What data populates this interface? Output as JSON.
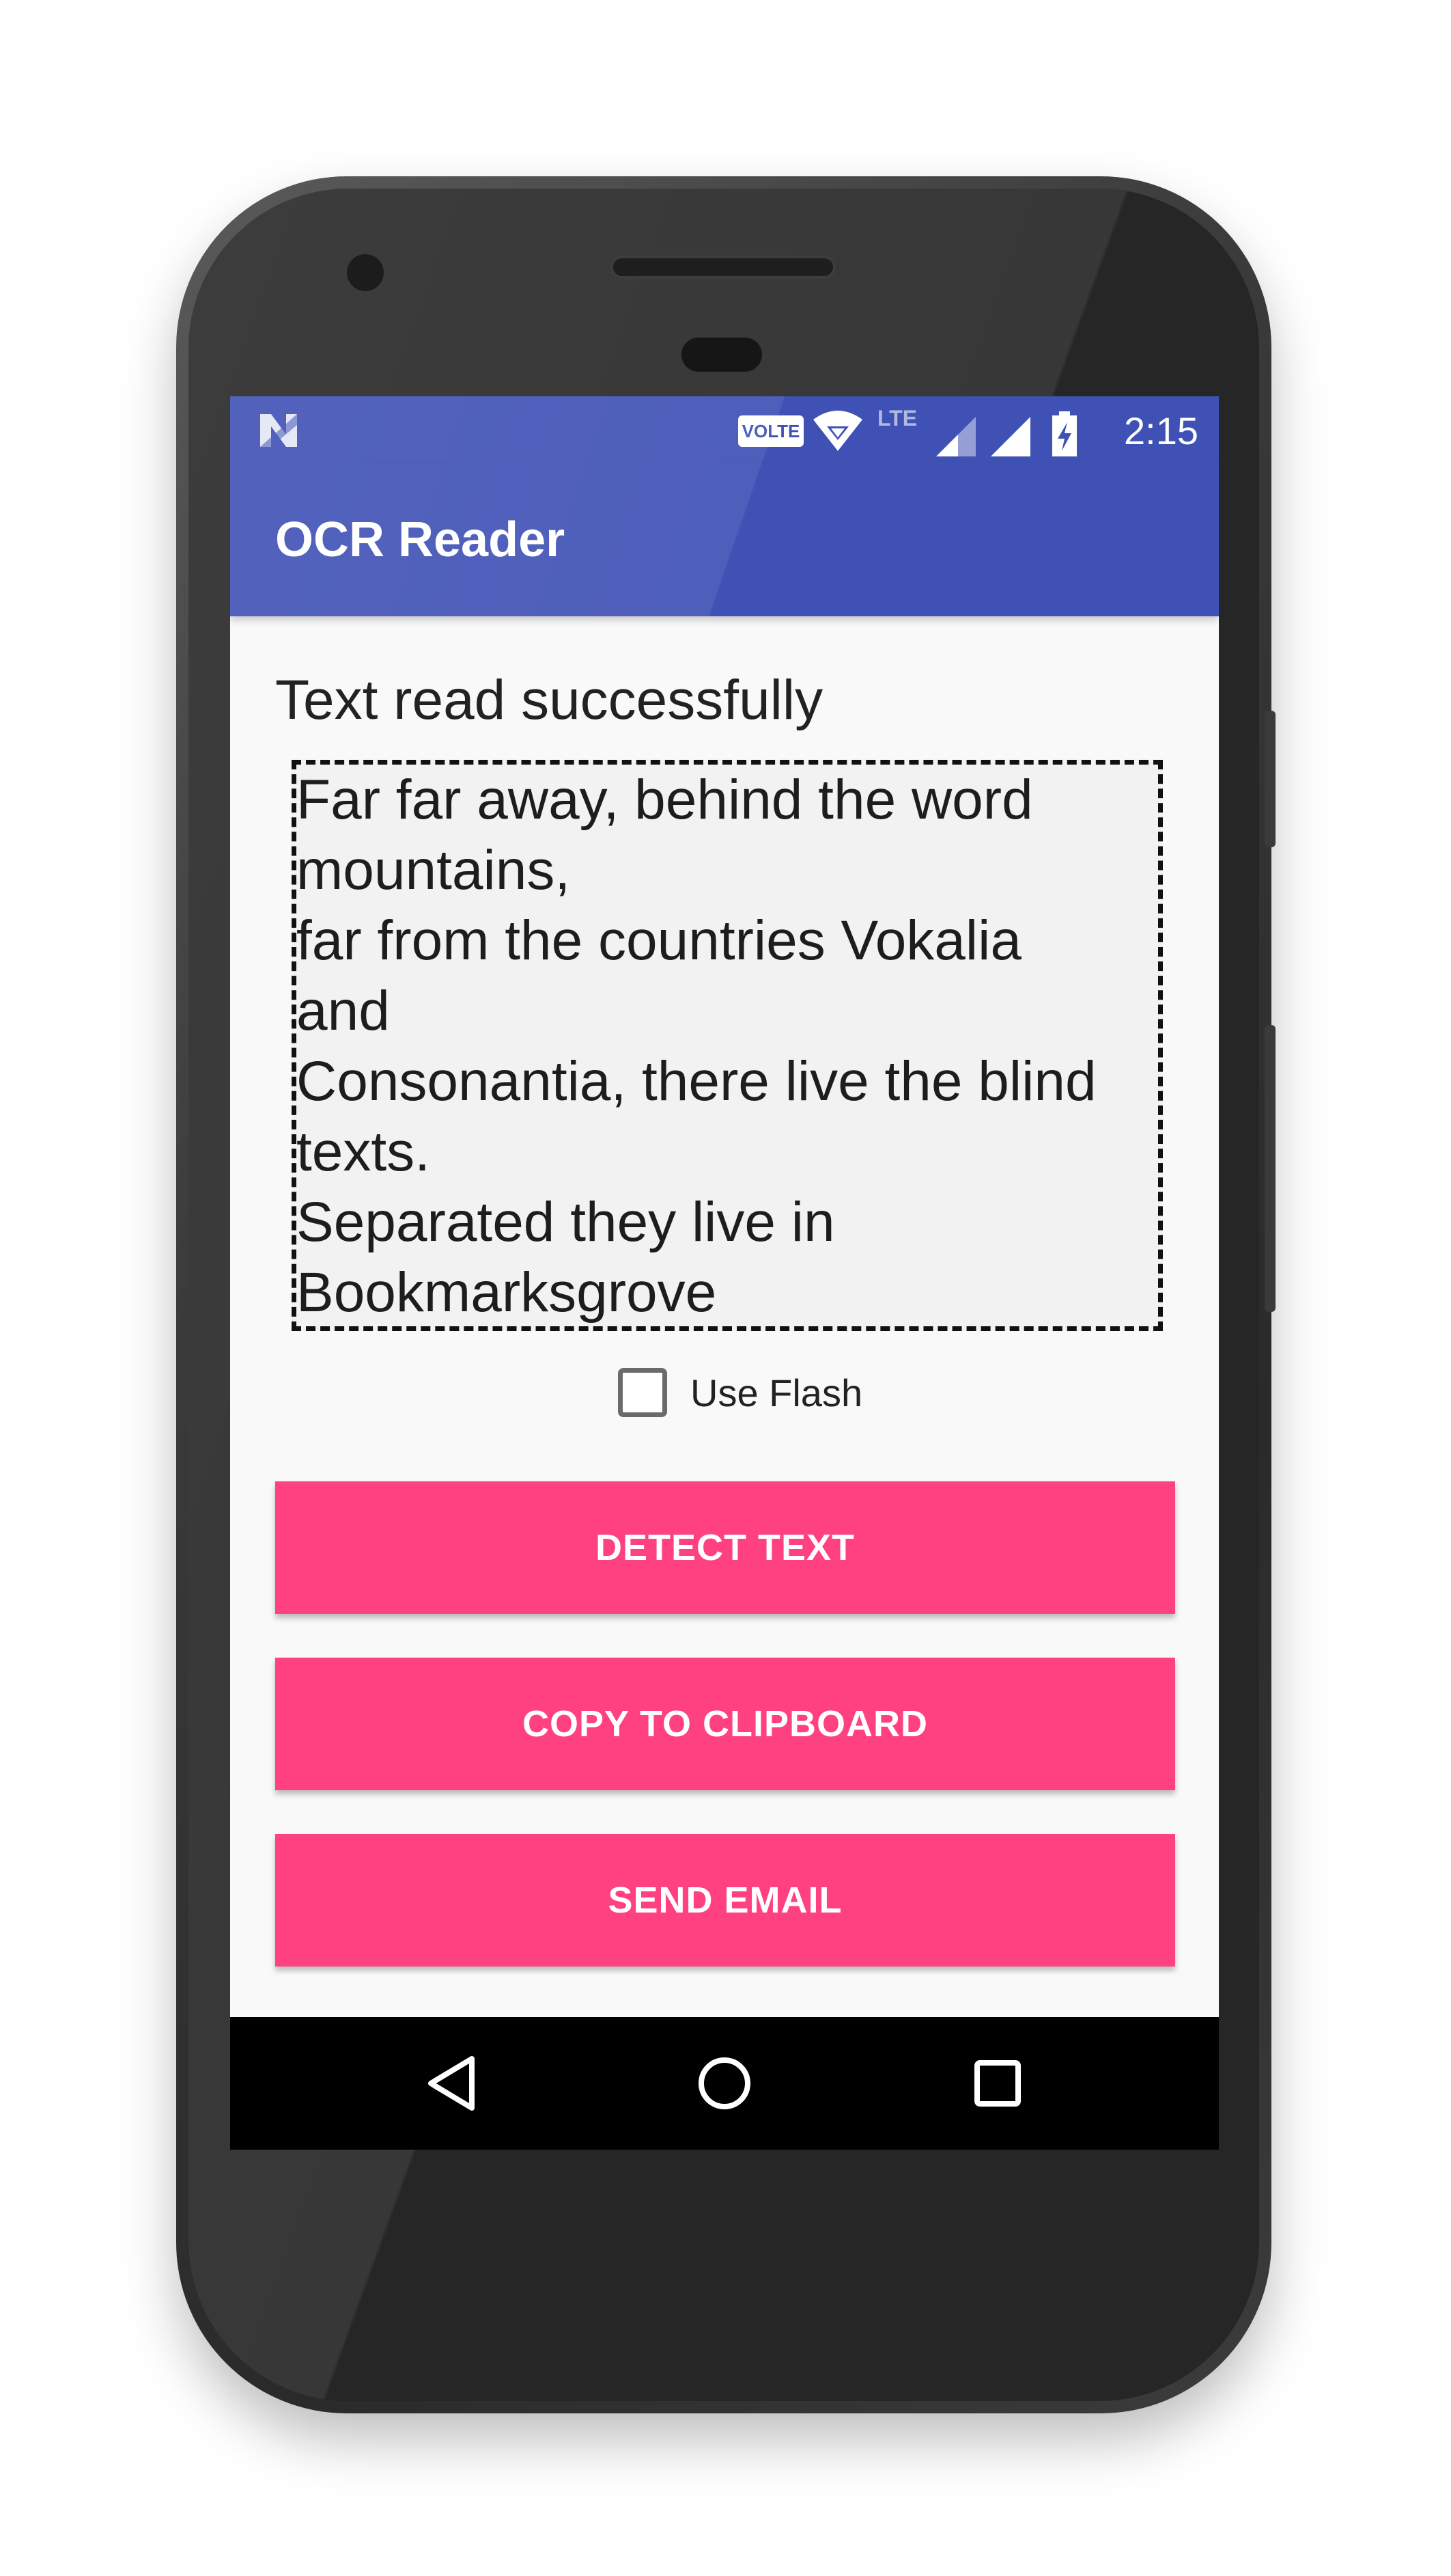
{
  "status_bar": {
    "time": "2:15",
    "volte_badge": "VOLTE",
    "lte_label": "LTE",
    "icons": [
      "notification-n-icon",
      "volte-icon",
      "wifi-icon",
      "lte-signal-icon",
      "cell-signal-icon",
      "battery-charging-icon"
    ]
  },
  "toolbar": {
    "title": "OCR Reader"
  },
  "main": {
    "status_message": "Text read successfully",
    "ocr_text": "Far far away, behind the word\nmountains,\nfar from the countries Vokalia\nand\nConsonantia, there live the blind\ntexts.\nSeparated they live in\nBookmarksgrove",
    "use_flash_label": "Use Flash",
    "use_flash_checked": false,
    "buttons": {
      "detect": "DETECT TEXT",
      "copy": "COPY TO CLIPBOARD",
      "email": "SEND EMAIL"
    }
  },
  "nav_bar": {
    "icons": [
      "back-icon",
      "home-icon",
      "recents-icon"
    ]
  },
  "colors": {
    "primary": "#3f51b5",
    "accent": "#ff4081",
    "background": "#f9f9f9",
    "nav": "#000000"
  }
}
